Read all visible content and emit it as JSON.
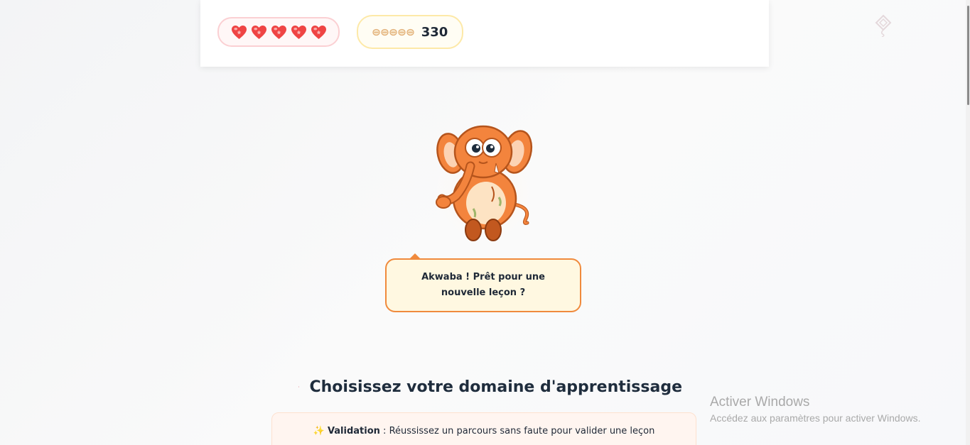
{
  "header": {
    "hearts": {
      "count": 5,
      "color": "#ef4444",
      "icon": "heart-icon"
    },
    "coins": {
      "icon": "coin-icon",
      "count_text": "330",
      "color": "#e0a96d"
    }
  },
  "mascot": {
    "icon": "elephant-mascot",
    "color": "#f3843d"
  },
  "speech": {
    "text": "Akwaba ! Prêt pour une nouvelle leçon ?"
  },
  "section": {
    "icon": "target-icon",
    "title": "Choisissez votre domaine d'apprentissage"
  },
  "validation": {
    "icon": "sparkles-icon",
    "icon_glyph": "✨",
    "label": "Validation",
    "text": " : Réussissez un parcours sans faute pour valider une leçon"
  },
  "watermark": {
    "title": "Activer Windows",
    "subtitle": "Accédez aux paramètres pour activer Windows."
  }
}
